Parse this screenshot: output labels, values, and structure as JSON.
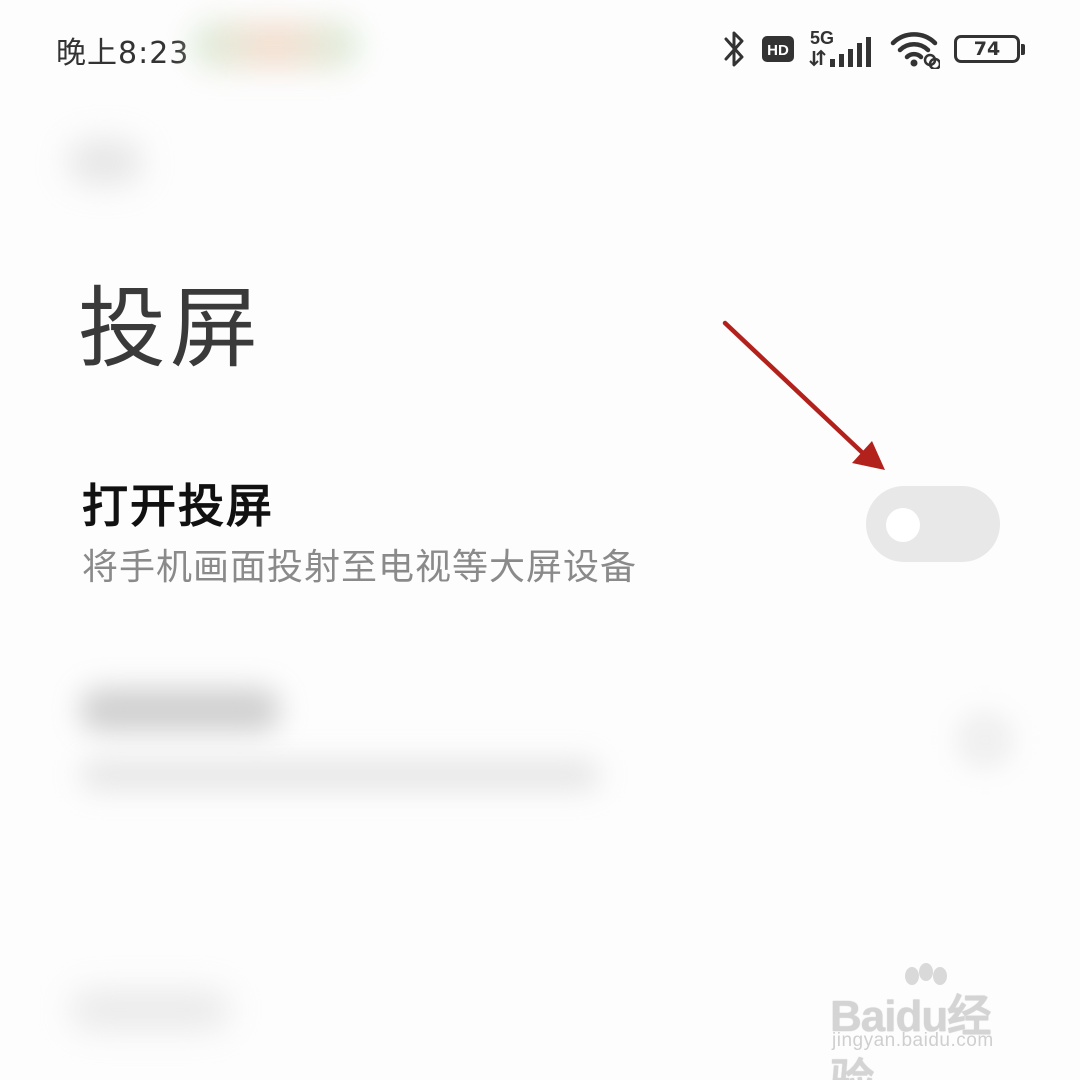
{
  "status_bar": {
    "time": "晚上8:23",
    "network_label": "5G",
    "hd_label": "HD",
    "battery_level": "74",
    "icons": [
      "bluetooth-icon",
      "hd-icon",
      "5g-signal-icon",
      "wifi-icon",
      "battery-icon"
    ]
  },
  "page": {
    "title": "投屏"
  },
  "cast_setting": {
    "label": "打开投屏",
    "description": "将手机画面投射至电视等大屏设备",
    "enabled": false
  },
  "watermark": {
    "logo_text": "Baidu经验",
    "url": "jingyan.baidu.com"
  },
  "colors": {
    "annotation_arrow": "#b3211d",
    "toggle_off": "#e8e8e8",
    "title_text": "#3a3a3a",
    "description_text": "#8a8a8a"
  }
}
